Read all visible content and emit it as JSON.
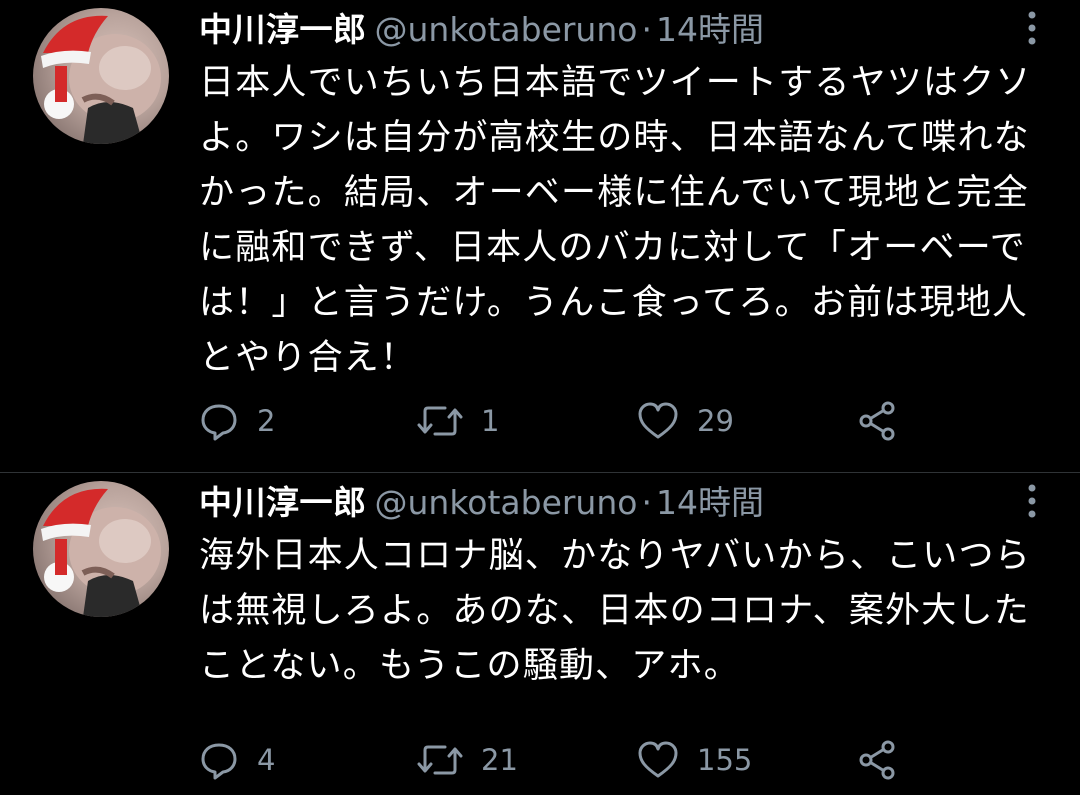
{
  "tweets": [
    {
      "author": {
        "display_name": "中川淳一郎",
        "handle": "@unkotaberuno"
      },
      "separator": "·",
      "time": "14時間",
      "text": "日本人でいちいち日本語でツイートするヤツはクソよ。ワシは自分が高校生の時、日本語なんて喋れなかった。結局、オーベー様に住んでいて現地と完全に融和できず、日本人のバカに対して「オーベーでは！」と言うだけ。うんこ食ってろ。お前は現地人とやり合え！",
      "stats": {
        "replies": "2",
        "retweets": "1",
        "likes": "29"
      },
      "icons": [
        "reply-icon",
        "retweet-icon",
        "like-icon",
        "share-icon",
        "more-icon"
      ]
    },
    {
      "author": {
        "display_name": "中川淳一郎",
        "handle": "@unkotaberuno"
      },
      "separator": "·",
      "time": "14時間",
      "text": "海外日本人コロナ脳、かなりヤバいから、こいつらは無視しろよ。あのな、日本のコロナ、案外大したことない。もうこの騒動、アホ。",
      "stats": {
        "replies": "4",
        "retweets": "21",
        "likes": "155"
      },
      "icons": [
        "reply-icon",
        "retweet-icon",
        "like-icon",
        "share-icon",
        "more-icon"
      ]
    }
  ],
  "colors": {
    "background": "#000000",
    "primary_text": "#ffffff",
    "secondary_text": "#8b98a5",
    "divider": "#2f3336"
  }
}
